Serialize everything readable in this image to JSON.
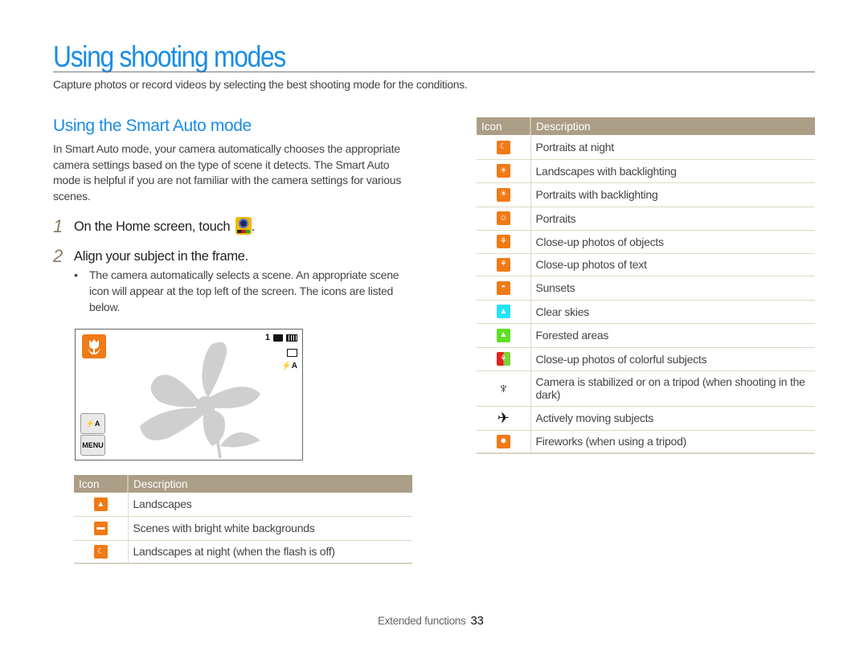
{
  "page": {
    "title": "Using shooting modes",
    "intro": "Capture photos or record videos by selecting the best shooting mode for the conditions."
  },
  "smart_auto": {
    "heading": "Using the Smart Auto mode",
    "description": "In Smart Auto mode, your camera automatically chooses the appropriate camera settings based on the type of scene it detects. The Smart Auto mode is helpful if you are not familiar with the camera settings for various scenes.",
    "steps": [
      {
        "number": "1",
        "text_before": "On the Home screen, touch",
        "text_after": ".",
        "icon": "smart-auto-app-icon"
      },
      {
        "number": "2",
        "text": "Align your subject in the frame."
      }
    ],
    "bullet": "The camera automatically selects a scene. An appropriate scene icon will appear at the top left of the screen. The icons are listed below."
  },
  "camera_screen": {
    "mode_icon": "macro-tulip-icon",
    "shot_count": "1",
    "status_icons": [
      "memory-card-icon",
      "battery-icon"
    ],
    "side_icons": [
      "image-size-icon",
      "flash-auto-icon"
    ],
    "flash_button_label": "⚡A",
    "menu_button_label": "MENU",
    "side_flash_label": "⚡A"
  },
  "table_left": {
    "headers": {
      "icon": "Icon",
      "description": "Description"
    },
    "rows": [
      {
        "icon": "landscape-icon",
        "color": "#f07a16",
        "glyph": "▲",
        "description": "Landscapes"
      },
      {
        "icon": "white-background-icon",
        "color": "#f07a16",
        "glyph": "▬",
        "description": "Scenes with bright white backgrounds"
      },
      {
        "icon": "night-landscape-icon",
        "color": "#f07a16",
        "glyph": "☾",
        "description": "Landscapes at night (when the flash is off)"
      }
    ]
  },
  "table_right": {
    "headers": {
      "icon": "Icon",
      "description": "Description"
    },
    "rows": [
      {
        "icon": "night-portrait-icon",
        "color": "#f07a16",
        "glyph": "☾",
        "description": "Portraits at night"
      },
      {
        "icon": "backlight-landscape-icon",
        "color": "#f07a16",
        "glyph": "☀",
        "description": "Landscapes with backlighting"
      },
      {
        "icon": "backlight-portrait-icon",
        "color": "#f07a16",
        "glyph": "☀",
        "description": "Portraits with backlighting"
      },
      {
        "icon": "portrait-icon",
        "color": "#f07a16",
        "glyph": "☺",
        "description": "Portraits"
      },
      {
        "icon": "macro-icon",
        "color": "#f07a16",
        "glyph": "⚘",
        "description": "Close-up photos of objects"
      },
      {
        "icon": "macro-text-icon",
        "color": "#f07a16",
        "glyph": "⚘",
        "description": "Close-up photos of text"
      },
      {
        "icon": "sunset-icon",
        "color": "#f07a16",
        "glyph": "◓",
        "description": "Sunsets"
      },
      {
        "icon": "clear-sky-icon",
        "color": "#22e4f4",
        "glyph": "▲",
        "description": "Clear skies"
      },
      {
        "icon": "forest-icon",
        "color": "#5fe024",
        "glyph": "▲",
        "description": "Forested areas"
      },
      {
        "icon": "macro-color-icon",
        "color": "multi",
        "glyph": "⚘",
        "description": "Close-up photos of colorful subjects"
      },
      {
        "icon": "tripod-icon",
        "color": "none",
        "glyph": "♆",
        "description": "Camera is stabilized or on a tripod (when shooting in the dark)"
      },
      {
        "icon": "action-icon",
        "color": "none",
        "glyph": "✈",
        "description": "Actively moving subjects"
      },
      {
        "icon": "fireworks-icon",
        "color": "#f07a16",
        "glyph": "✹",
        "description": "Fireworks (when using a tripod)"
      }
    ]
  },
  "footer": {
    "section": "Extended functions",
    "page_number": "33"
  }
}
